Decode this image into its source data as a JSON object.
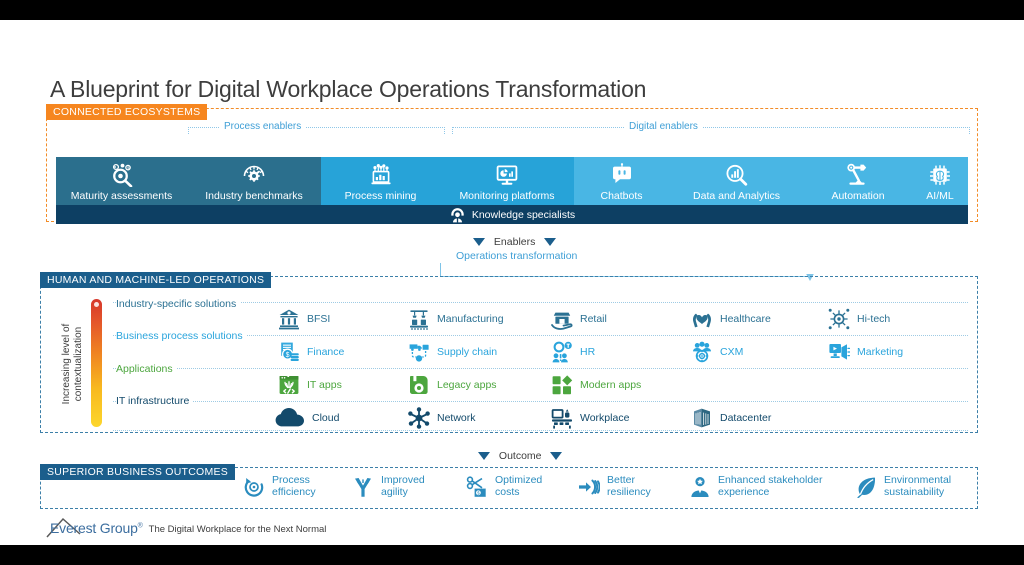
{
  "title": "A Blueprint for Digital Workplace Operations Transformation",
  "sections": {
    "connected_ecosystems": {
      "badge": "CONNECTED ECOSYSTEMS",
      "badge_color": "#f6861f",
      "brackets": [
        {
          "label": "Process enablers"
        },
        {
          "label": "Digital enablers"
        }
      ],
      "cells": [
        {
          "label": "Maturity assessments",
          "icon": "maturity-assessment-icon",
          "color": "#2b6f8d"
        },
        {
          "label": "Industry benchmarks",
          "icon": "speedometer-gear-icon",
          "color": "#2b6f8d"
        },
        {
          "label": "Process mining",
          "icon": "bar-chart-laptop-icon",
          "color": "#27a3d8"
        },
        {
          "label": "Monitoring platforms",
          "icon": "monitor-analytics-icon",
          "color": "#27a3d8"
        },
        {
          "label": "Chatbots",
          "icon": "chatbot-icon",
          "color": "#49b6e4"
        },
        {
          "label": "Data and Analytics",
          "icon": "magnifier-chart-icon",
          "color": "#49b6e4"
        },
        {
          "label": "Automation",
          "icon": "robot-arm-icon",
          "color": "#49b6e4"
        },
        {
          "label": "AI/ML",
          "icon": "ai-chip-brain-icon",
          "color": "#49b6e4"
        }
      ],
      "knowledge_bar": {
        "label": "Knowledge specialists",
        "icon": "knowledge-specialist-icon",
        "color": "#0d3f63"
      }
    },
    "connector_top": {
      "label": "Enablers",
      "sub_label": "Operations transformation"
    },
    "operations": {
      "badge": "HUMAN AND MACHINE-LED OPERATIONS",
      "badge_color": "#1b5e8c",
      "axis_label": "Increasing level of\ncontextualization",
      "axis_label_line1": "Increasing level of",
      "axis_label_line2": "contextualization",
      "thermo_top_color": "#d6372b",
      "thermo_bottom_color": "#fcd62c",
      "rows": [
        {
          "label": "Industry-specific solutions",
          "color": "#2b7193",
          "items": [
            {
              "label": "BFSI",
              "icon": "bank-icon"
            },
            {
              "label": "Manufacturing",
              "icon": "factory-machine-icon"
            },
            {
              "label": "Retail",
              "icon": "retail-store-hand-icon"
            },
            {
              "label": "Healthcare",
              "icon": "heart-hands-icon"
            },
            {
              "label": "Hi-tech",
              "icon": "chip-network-icon"
            }
          ]
        },
        {
          "label": "Business process solutions",
          "color": "#29a4dc",
          "items": [
            {
              "label": "Finance",
              "icon": "finance-money-icon"
            },
            {
              "label": "Supply chain",
              "icon": "supply-chain-icon"
            },
            {
              "label": "HR",
              "icon": "hr-people-icon"
            },
            {
              "label": "CXM",
              "icon": "cxm-customer-icon"
            },
            {
              "label": "Marketing",
              "icon": "marketing-screen-icon"
            }
          ]
        },
        {
          "label": "Applications",
          "color": "#4ca63e",
          "items": [
            {
              "label": "IT apps",
              "icon": "it-apps-code-icon"
            },
            {
              "label": "Legacy apps",
              "icon": "legacy-floppy-icon"
            },
            {
              "label": "Modern apps",
              "icon": "modern-apps-blocks-icon"
            }
          ]
        },
        {
          "label": "IT infrastructure",
          "color": "#134a6b",
          "items": [
            {
              "label": "Cloud",
              "icon": "cloud-icon"
            },
            {
              "label": "Network",
              "icon": "network-nodes-icon"
            },
            {
              "label": "Workplace",
              "icon": "workplace-desk-icon"
            },
            {
              "label": "Datacenter",
              "icon": "datacenter-server-icon"
            }
          ]
        }
      ]
    },
    "connector_bottom": {
      "label": "Outcome"
    },
    "outcomes": {
      "badge": "SUPERIOR BUSINESS OUTCOMES",
      "badge_color": "#1b5e8c",
      "items": [
        {
          "line1": "Process",
          "line2": "efficiency",
          "icon": "process-efficiency-icon"
        },
        {
          "line1": "Improved",
          "line2": "agility",
          "icon": "improved-agility-icon"
        },
        {
          "line1": "Optimized",
          "line2": "costs",
          "icon": "optimized-costs-icon"
        },
        {
          "line1": "Better",
          "line2": "resiliency",
          "icon": "better-resiliency-icon"
        },
        {
          "line1": "Enhanced stakeholder",
          "line2": "experience",
          "icon": "stakeholder-experience-icon"
        },
        {
          "line1": "Environmental",
          "line2": "sustainability",
          "icon": "leaf-sustainability-icon"
        }
      ]
    },
    "footer": {
      "logo": "Everest Group",
      "logo_registered": "®",
      "tagline": "The Digital Workplace for the Next Normal"
    }
  }
}
